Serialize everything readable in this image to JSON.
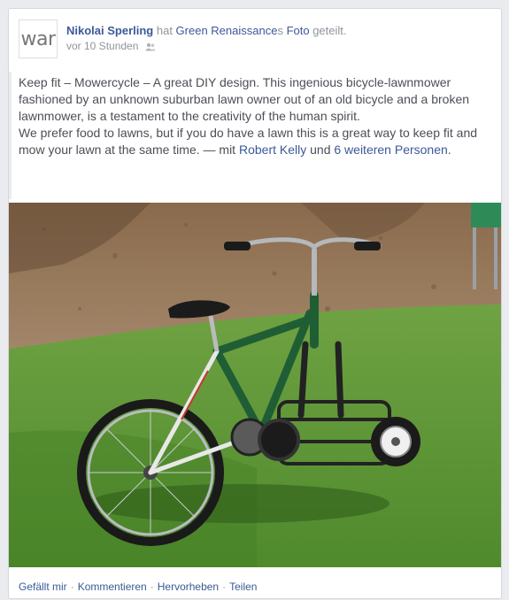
{
  "post": {
    "avatar_text": "war",
    "author": "Nikolai Sperling",
    "verb": " hat ",
    "page_name": "Green Renaissance",
    "possessive": "s ",
    "photo_word": "Foto",
    "verb_end": " geteilt.",
    "timestamp": "vor 10 Stunden",
    "privacy_icon": "friends-icon",
    "text_line1": "Keep fit – Mowercycle – A great DIY design. This ingenious bicycle-lawnmower fashioned by an unknown suburban lawn owner out of an old bicycle and a broken lawnmower, is a testament to the creativity of the human spirit.",
    "text_line2_prefix": "We prefer food to lawns, but if you do have a lawn this is a great way to keep fit and mow your lawn at the same time. — mit ",
    "tag_person": "Robert Kelly",
    "tag_and": " und ",
    "tag_others": "6 weiteren Personen",
    "tag_end": "."
  },
  "actions": {
    "like": "Gefällt mir",
    "comment": "Kommentieren",
    "highlight": "Hervorheben",
    "share": "Teilen",
    "separator": "·"
  },
  "colors": {
    "link": "#3b5998",
    "meta": "#90949c",
    "body_text": "#4b4f56",
    "bike_frame": "#1f5e35"
  }
}
